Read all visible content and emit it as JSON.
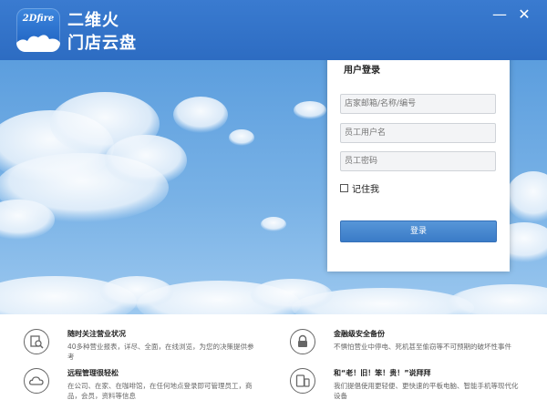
{
  "app": {
    "logo_text": "2Dfire",
    "brand_line1": "二维火",
    "brand_line2": "门店云盘",
    "minimize_glyph": "—",
    "close_glyph": "✕"
  },
  "login": {
    "title": "用户登录",
    "store_placeholder": "店家邮箱/名称/编号",
    "staff_placeholder": "员工用户名",
    "password_placeholder": "员工密码",
    "remember_label": "记住我",
    "remember_checked": false,
    "submit_label": "登录"
  },
  "features": [
    {
      "icon": "document-magnifier-icon",
      "title": "随时关注营业状况",
      "desc": "40多种营业报表，详尽、全面，在线浏览，为您的决策提供参考"
    },
    {
      "icon": "lock-icon",
      "title": "金融级安全备份",
      "desc": "不惧怕营业中停电、死机甚至偷窃等不可预期的破坏性事件"
    },
    {
      "icon": "cloud-icon",
      "title": "远程管理很轻松",
      "desc": "在公司、在家、在咖啡馆，在任何地点登录即可管理员工，商品，会员，资料等信息"
    },
    {
      "icon": "phone-tablet-icon",
      "title": "和“老！旧！笨！贵！”说拜拜",
      "desc": "我们提倡使用更轻便、更快速的平板电脑、智能手机等现代化设备"
    }
  ],
  "colors": {
    "header": "#2d6cc2",
    "button": "#3a7bc7",
    "sky_top": "#5c9ede"
  }
}
